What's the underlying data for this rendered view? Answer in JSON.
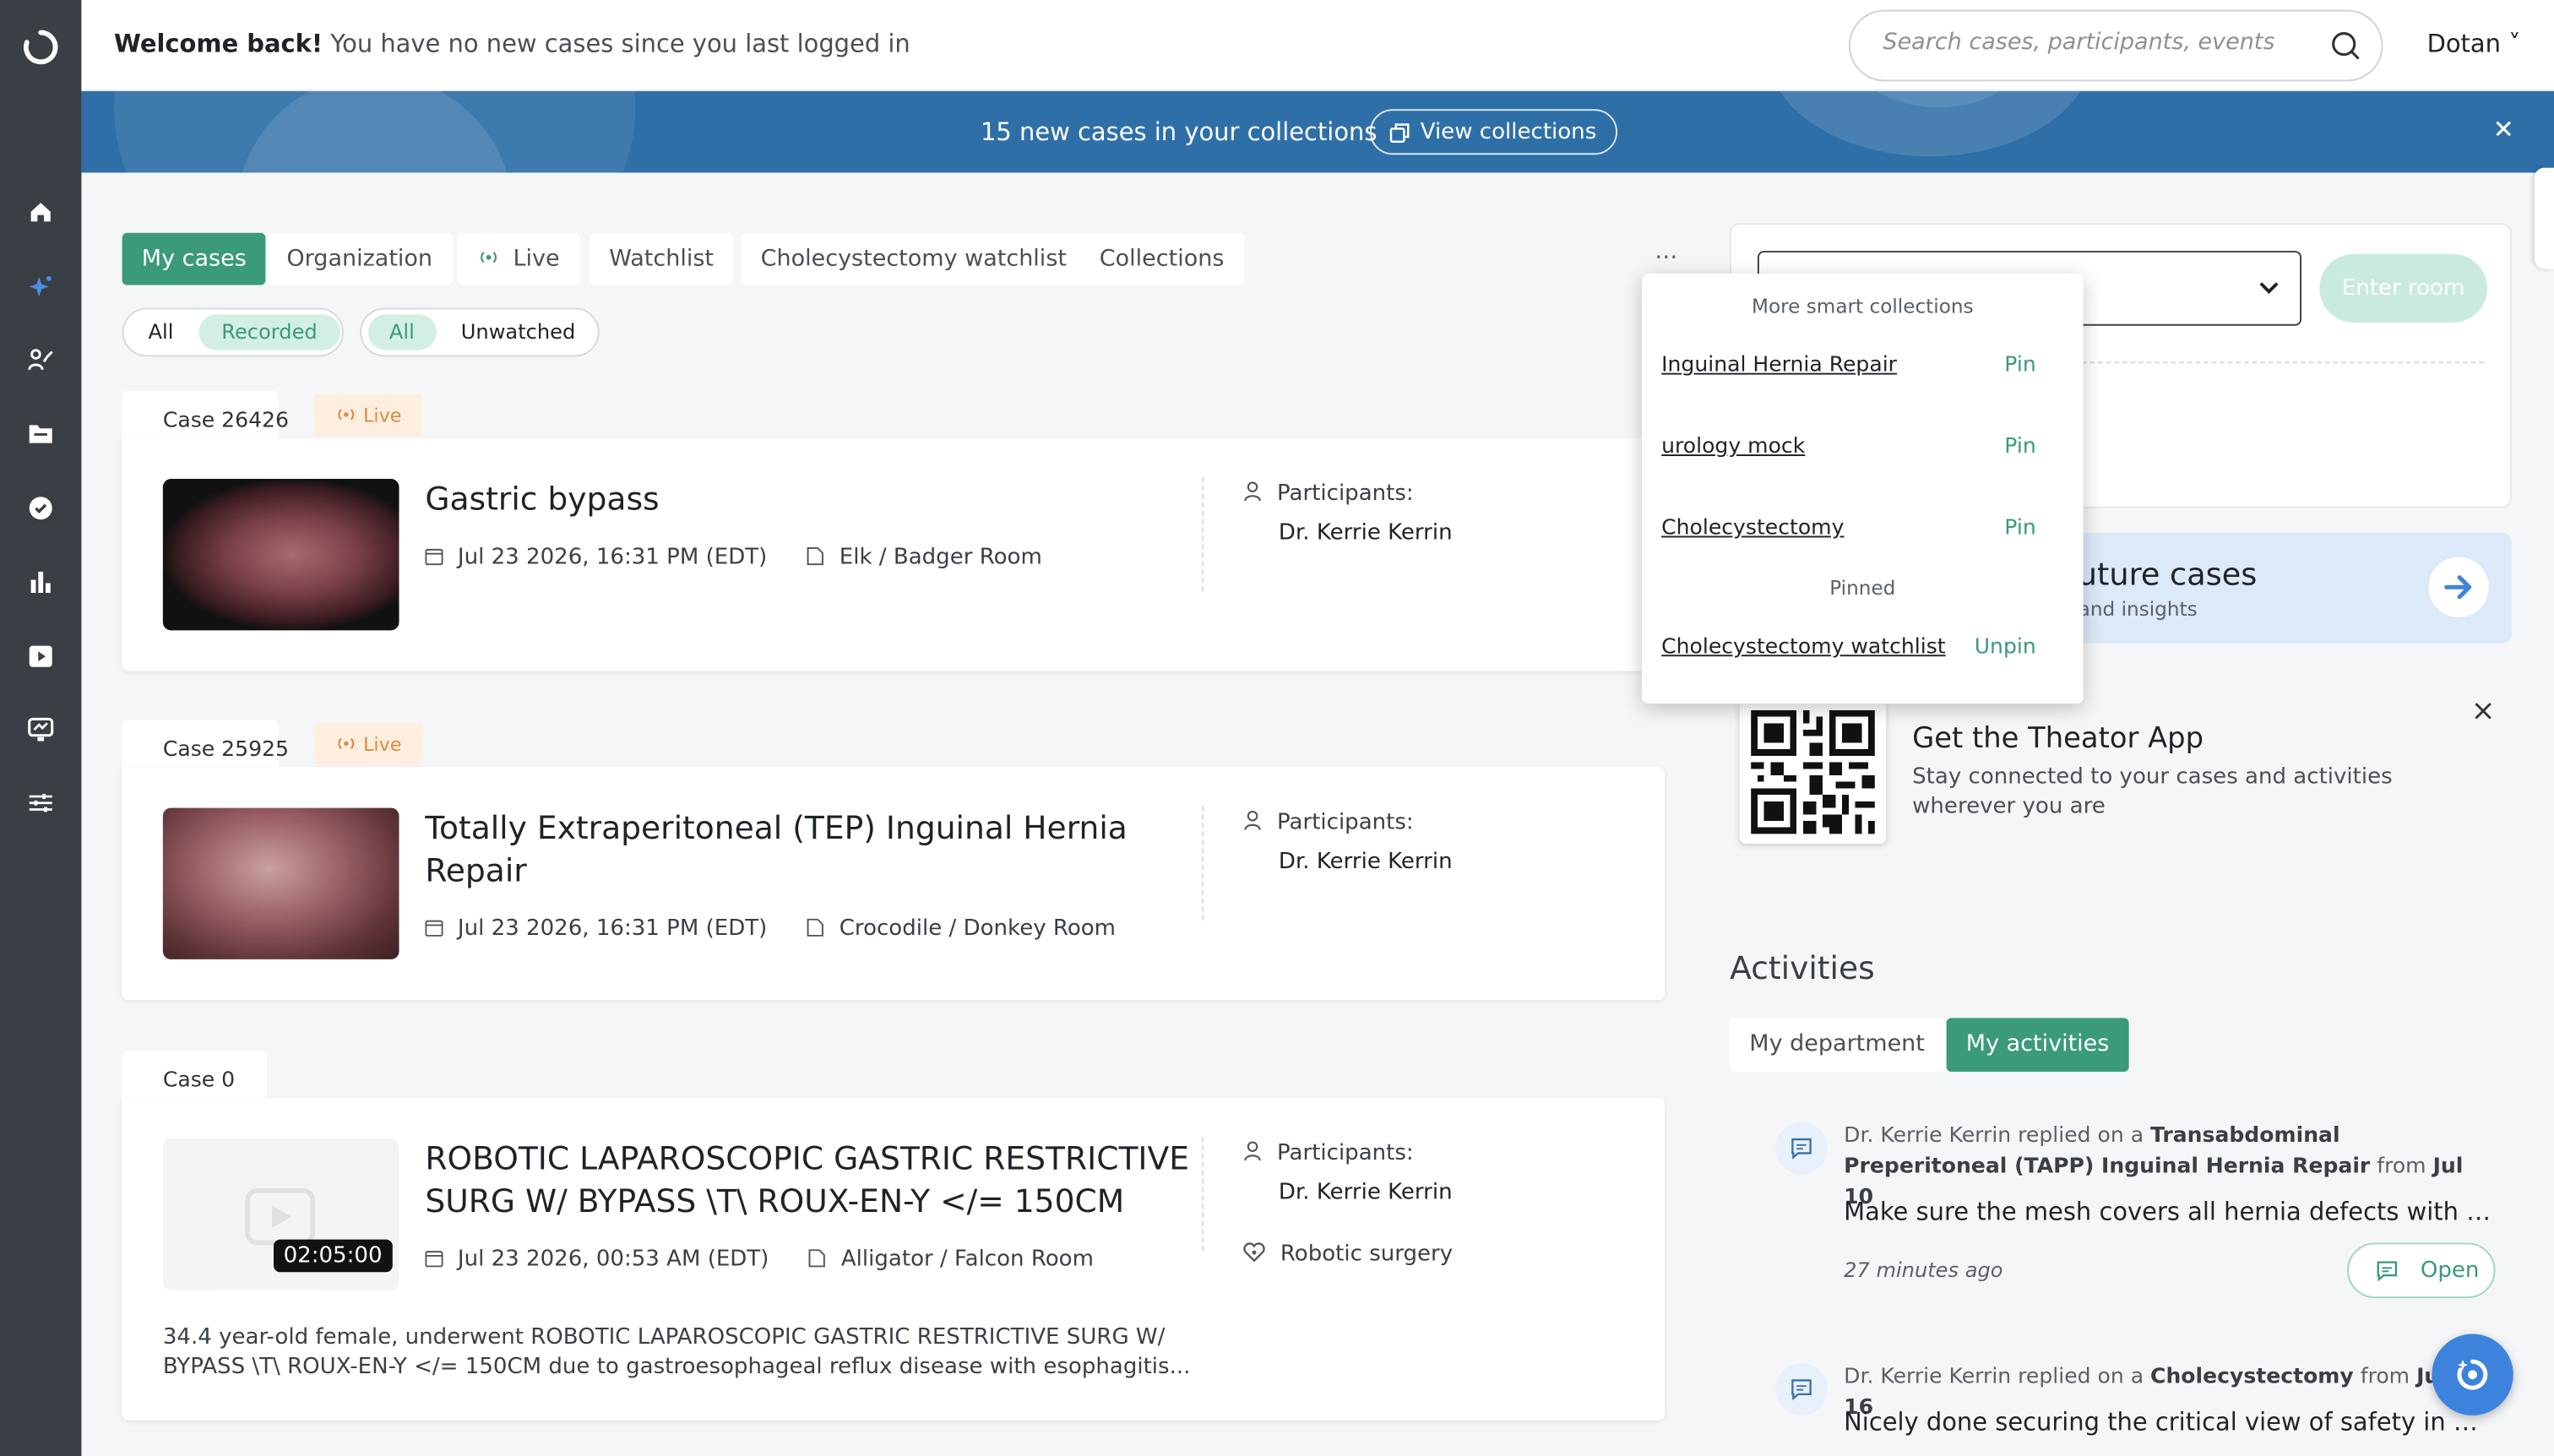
{
  "topbar": {
    "welcome_bold": "Welcome back!",
    "welcome_rest": " You have no new cases since you last logged in",
    "search_placeholder": "Search cases, participants, events",
    "user": "Dotan ˅"
  },
  "banner": {
    "text": "15 new cases in your collections",
    "button": "View collections"
  },
  "tabs": [
    "My cases",
    "Organization",
    "Live",
    "Watchlist",
    "Cholecystectomy watchlist",
    "Collections"
  ],
  "kebab": "⋯",
  "filters": {
    "recorded_toggle": [
      "All",
      "Recorded"
    ],
    "watched_toggle": [
      "All",
      "Unwatched"
    ]
  },
  "cases": [
    {
      "case_label": "Case 26426",
      "live": "Live",
      "title": "Gastric bypass",
      "date": "Jul 23 2026, 16:31 PM (EDT)",
      "room": "Elk / Badger Room",
      "participants_label": "Participants:",
      "participant": "Dr. Kerrie Kerrin"
    },
    {
      "case_label": "Case 25925",
      "live": "Live",
      "title": "Totally Extraperitoneal (TEP) Inguinal Hernia Repair",
      "date": "Jul 23 2026, 16:31 PM (EDT)",
      "room": "Crocodile / Donkey Room",
      "participants_label": "Participants:",
      "participant": "Dr. Kerrie Kerrin"
    },
    {
      "case_label": "Case 0",
      "title": "ROBOTIC LAPAROSCOPIC GASTRIC RESTRICTIVE SURG W/ BYPASS \\T\\ ROUX-EN-Y </= 150CM",
      "duration": "02:05:00",
      "date": "Jul 23 2026, 00:53 AM (EDT)",
      "room": "Alligator / Falcon Room",
      "participants_label": "Participants:",
      "participant": "Dr. Kerrie Kerrin",
      "tag": "Robotic surgery",
      "description": "34.4 year-old female, underwent ROBOTIC LAPAROSCOPIC GASTRIC RESTRICTIVE SURG W/ BYPASS \\T\\ ROUX-EN-Y </= 150CM due to gastroesophageal reflux disease with esophagitis..."
    }
  ],
  "room_panel": {
    "enter_button": "Enter room"
  },
  "future": {
    "title": "your future cases",
    "subtitle": "ase prep and insights"
  },
  "app_promo": {
    "title": "Get the Theator App",
    "subtitle": "Stay connected to your cases and activities wherever you are"
  },
  "popup": {
    "header": "More smart collections",
    "items": [
      {
        "label": "Inguinal Hernia Repair",
        "action": "Pin"
      },
      {
        "label": "urology mock",
        "action": "Pin"
      },
      {
        "label": "Cholecystectomy",
        "action": "Pin"
      }
    ],
    "pinned_header": "Pinned",
    "pinned": [
      {
        "label": "Cholecystectomy watchlist",
        "action": "Unpin"
      }
    ]
  },
  "activities": {
    "title": "Activities",
    "tabs": [
      "My department",
      "My activities"
    ],
    "items": [
      {
        "author": "Dr. Kerrie Kerrin replied on a ",
        "subject": "Transabdominal Preperitoneal (TAPP) Inguinal Hernia Repair",
        "from": " from ",
        "date": "Jul 10",
        "message": "Make sure the mesh covers all hernia defects with m...",
        "time": "27 minutes ago",
        "open": "Open"
      },
      {
        "author": "Dr. Kerrie Kerrin replied on a ",
        "subject": "Cholecystectomy",
        "from": " from ",
        "date": "Jul 16",
        "message": "Nicely done securing the critical view of safety in th..."
      }
    ]
  },
  "colors": {
    "sidebar": "#3a3f46",
    "accent": "#3a9a7a",
    "banner": "#2f6fa8",
    "live": "#e08a3c",
    "fab": "#3d83dd"
  }
}
